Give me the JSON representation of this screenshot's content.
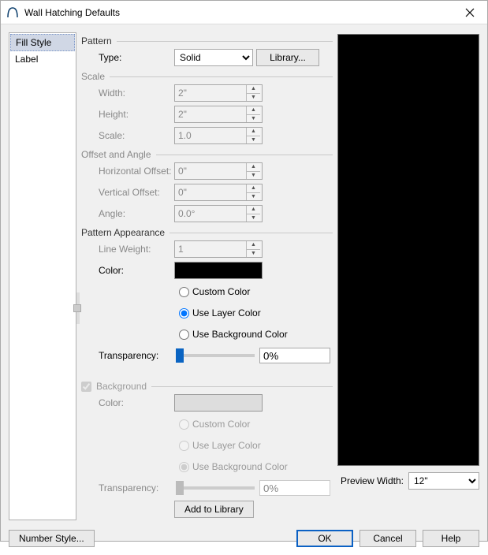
{
  "dialog": {
    "title": "Wall Hatching Defaults"
  },
  "sidebar": {
    "tabs": [
      {
        "label": "Fill Style",
        "active": true
      },
      {
        "label": "Label",
        "active": false
      }
    ]
  },
  "pattern": {
    "title": "Pattern",
    "type_label": "Type:",
    "type_value": "Solid",
    "library_btn": "Library..."
  },
  "scale": {
    "title": "Scale",
    "width_label": "Width:",
    "width_value": "2\"",
    "height_label": "Height:",
    "height_value": "2\"",
    "scale_label": "Scale:",
    "scale_value": "1.0"
  },
  "offset": {
    "title": "Offset and Angle",
    "hoff_label": "Horizontal Offset:",
    "hoff_value": "0\"",
    "voff_label": "Vertical Offset:",
    "voff_value": "0\"",
    "angle_label": "Angle:",
    "angle_value": "0.0°"
  },
  "appearance": {
    "title": "Pattern Appearance",
    "lw_label": "Line Weight:",
    "lw_value": "1",
    "color_label": "Color:",
    "radio_custom": "Custom Color",
    "radio_layer": "Use Layer Color",
    "radio_bg": "Use Background Color",
    "transp_label": "Transparency:",
    "transp_value": "0%"
  },
  "background": {
    "chk_label": "Background",
    "color_label": "Color:",
    "radio_custom": "Custom Color",
    "radio_layer": "Use Layer Color",
    "radio_bg": "Use Background Color",
    "transp_label": "Transparency:",
    "transp_value": "0%",
    "add_btn": "Add to Library"
  },
  "preview": {
    "width_label": "Preview Width:",
    "width_value": "12\""
  },
  "footer": {
    "number_style": "Number Style...",
    "ok": "OK",
    "cancel": "Cancel",
    "help": "Help"
  }
}
